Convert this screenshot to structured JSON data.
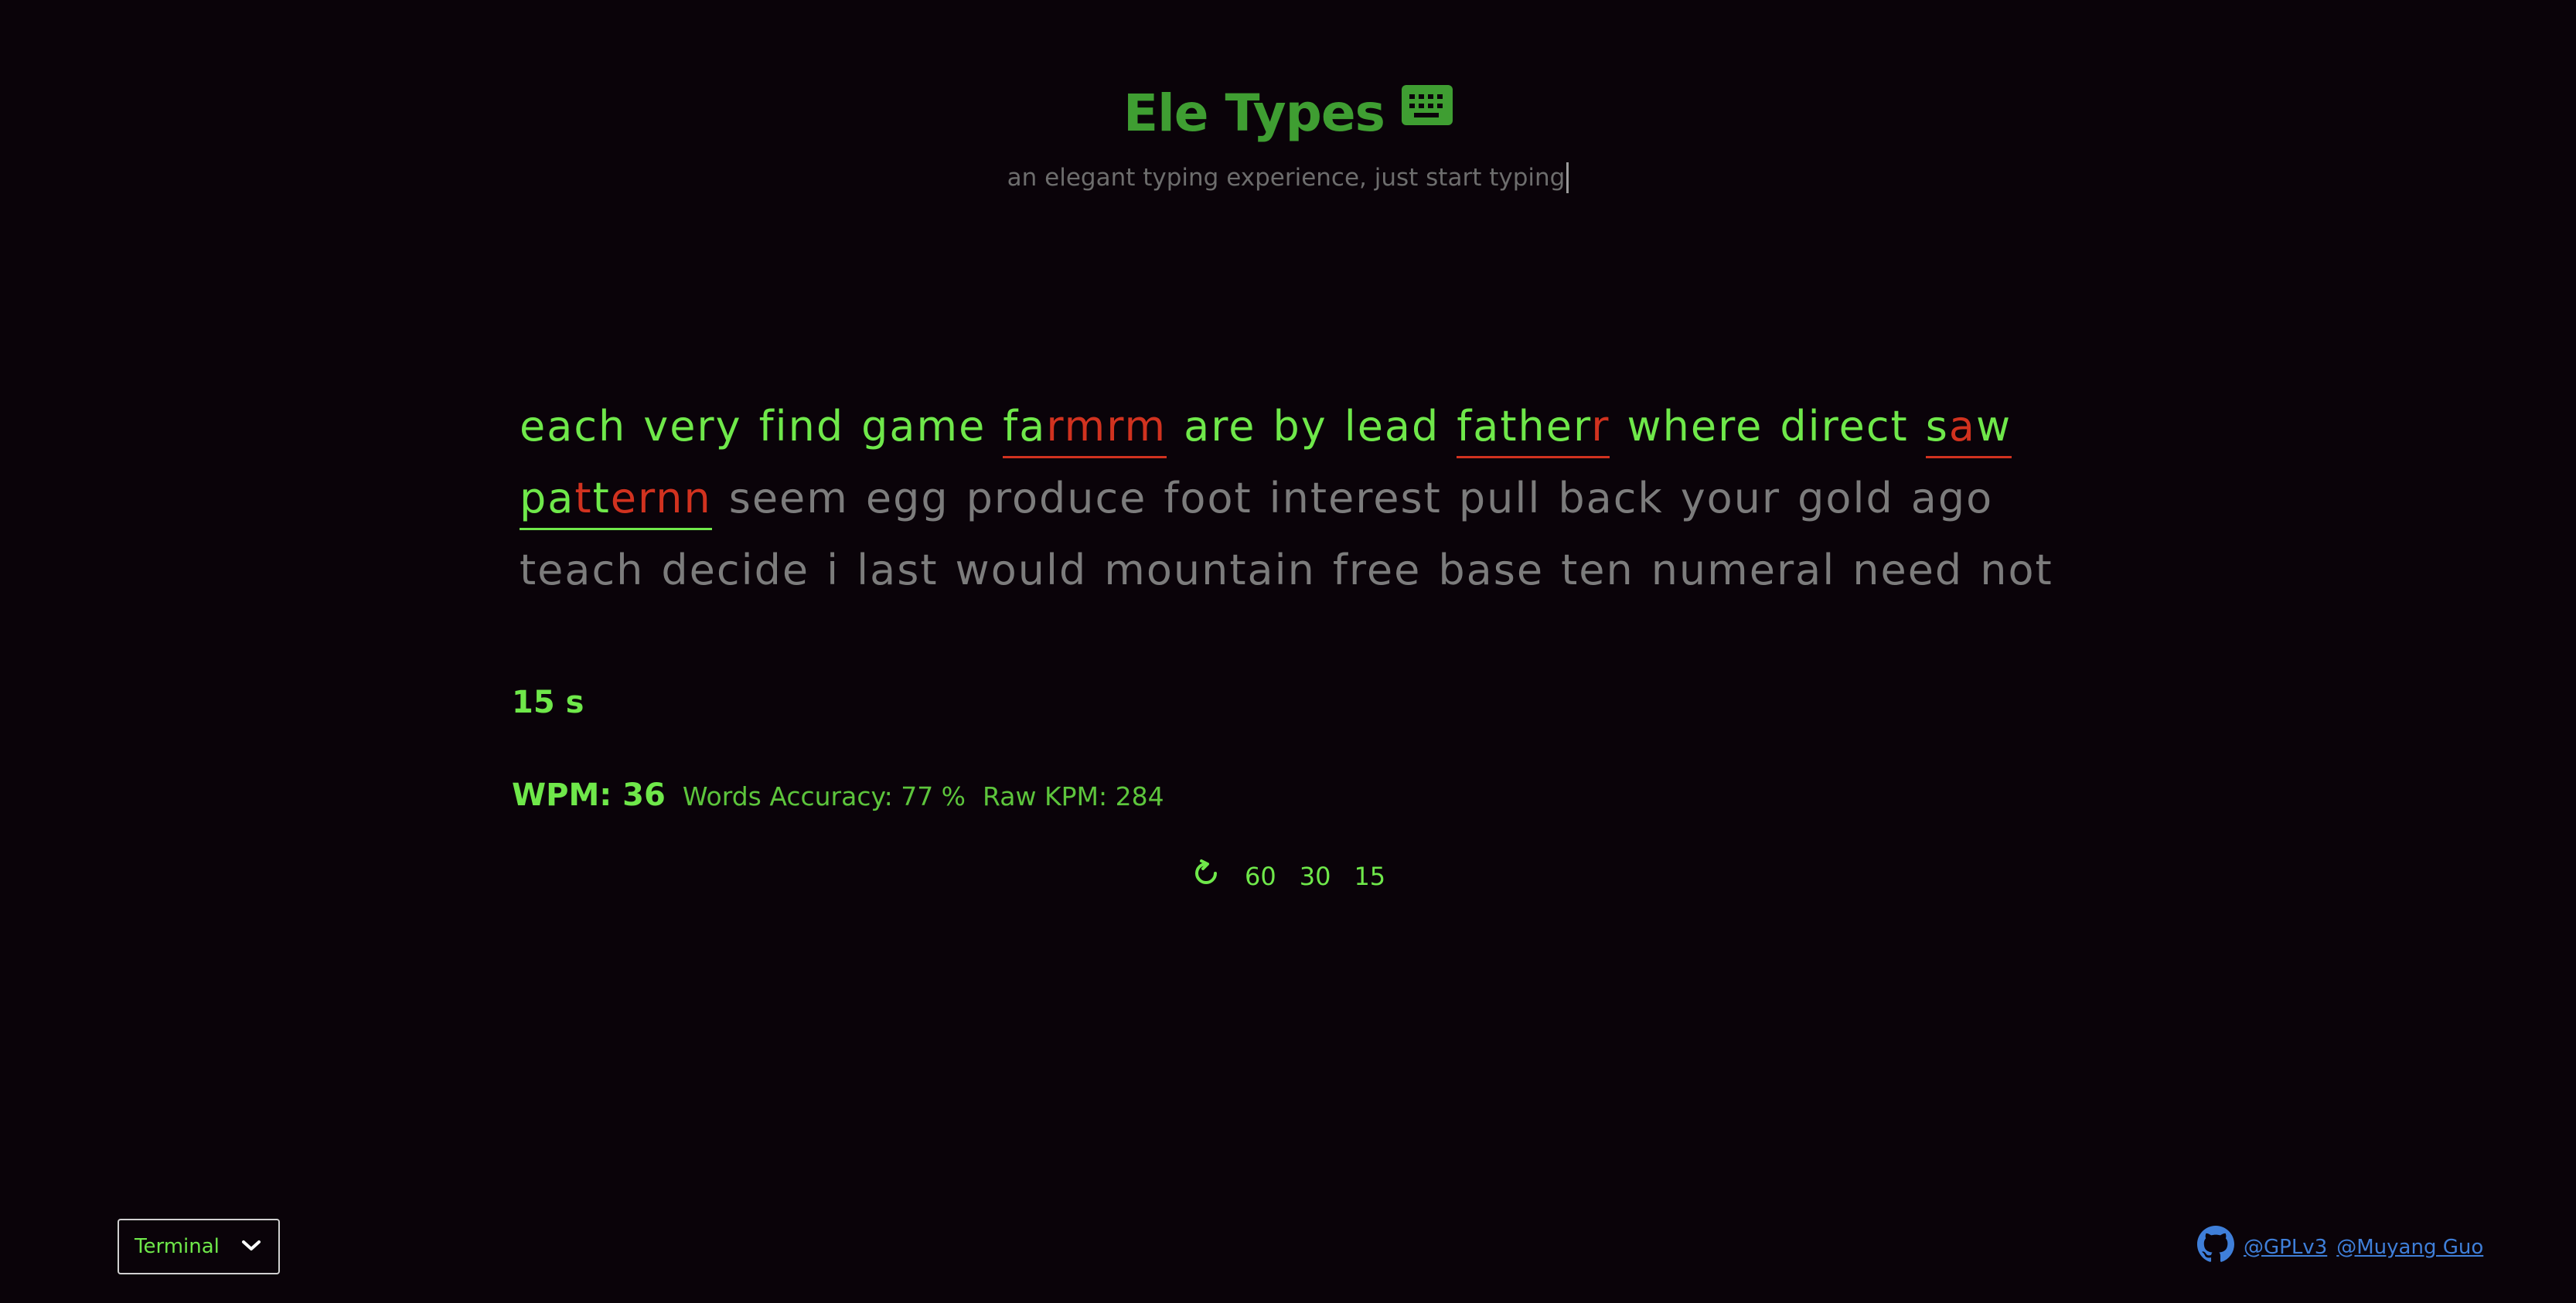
{
  "header": {
    "title": "Ele Types",
    "subtitle": "an elegant typing experience, just start typing",
    "title_icon": "keyboard-icon"
  },
  "words": {
    "line1": [
      "each",
      "very",
      "find",
      "game",
      "farmrm",
      "are",
      "by",
      "lead",
      "fatherr",
      "where",
      "direct",
      "saw"
    ],
    "line2": [
      "pattern",
      "seem",
      "egg",
      "produce",
      "foot",
      "interest",
      "pull",
      "back",
      "your",
      "gold",
      "ago"
    ],
    "line3": [
      "teach",
      "decide",
      "i",
      "last",
      "would",
      "mountain",
      "free",
      "base",
      "ten",
      "numeral",
      "need",
      "not"
    ]
  },
  "timer": {
    "label": "15 s"
  },
  "stats": {
    "wpm": "WPM: 36",
    "accuracy": "Words Accuracy: 77 %",
    "raw_kpm": "Raw KPM: 284"
  },
  "controls": {
    "restart_icon": "restart-icon",
    "opt60": "60",
    "opt30": "30",
    "opt15": "15"
  },
  "theme": {
    "selected": "Terminal",
    "icon": "chevron-down-icon"
  },
  "footer": {
    "license_label": "@GPLv3",
    "author_label": "@Muyang Guo",
    "icon": "github-icon"
  },
  "colors": {
    "background": "#0a0309",
    "correct": "#6fe84a",
    "error": "#d1321f",
    "pending": "#7c7c7c",
    "title": "#3f9e32",
    "link": "#3f7fd9"
  }
}
